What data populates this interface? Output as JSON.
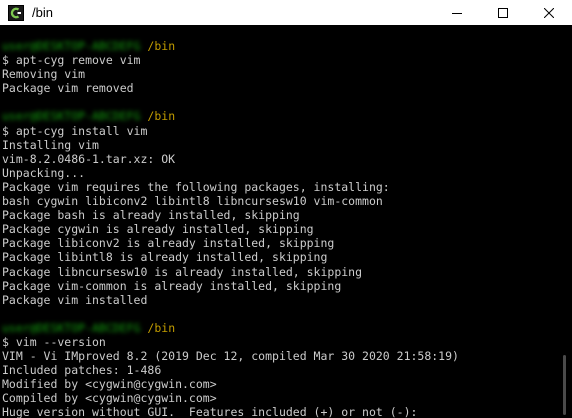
{
  "window": {
    "title": "/bin",
    "app_icon": "cygwin-terminal-icon",
    "controls": [
      "minimize-icon",
      "maximize-icon",
      "close-icon"
    ]
  },
  "colors": {
    "background": "#000000",
    "text": "#cccccc",
    "prompt_user": "#13a10e",
    "prompt_path": "#c19c00"
  },
  "prompt": {
    "user_host": "user@DESKTOP-ABCDEFG",
    "path": "/bin"
  },
  "terminal": {
    "blocks": [
      {
        "command": "$ apt-cyg remove vim",
        "output": [
          "Removing vim",
          "Package vim removed"
        ]
      },
      {
        "command": "$ apt-cyg install vim",
        "output": [
          "Installing vim",
          "vim-8.2.0486-1.tar.xz: OK",
          "Unpacking...",
          "Package vim requires the following packages, installing:",
          "bash cygwin libiconv2 libintl8 libncursesw10 vim-common",
          "Package bash is already installed, skipping",
          "Package cygwin is already installed, skipping",
          "Package libiconv2 is already installed, skipping",
          "Package libintl8 is already installed, skipping",
          "Package libncursesw10 is already installed, skipping",
          "Package vim-common is already installed, skipping",
          "Package vim installed"
        ]
      },
      {
        "command": "$ vim --version",
        "output": [
          "VIM - Vi IMproved 8.2 (2019 Dec 12, compiled Mar 30 2020 21:58:19)",
          "Included patches: 1-486",
          "Modified by <cygwin@cygwin.com>",
          "Compiled by <cygwin@cygwin.com>",
          "Huge version without GUI.  Features included (+) or not (-):"
        ]
      }
    ]
  }
}
